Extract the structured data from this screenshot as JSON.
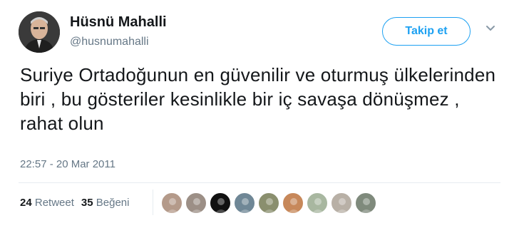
{
  "author": {
    "name": "Hüsnü Mahalli",
    "handle": "@husnumahalli"
  },
  "follow_button_label": "Takip et",
  "tweet": {
    "text": "Suriye Ortadoğunun en güvenilir ve oturmuş ülkelerinden biri , bu gösteriler kesinlikle bir iç savaşa dönüşmez , rahat olun",
    "timestamp": "22:57 - 20 Mar 2011"
  },
  "stats": {
    "retweets_count": "24",
    "retweets_label": "Retweet",
    "likes_count": "35",
    "likes_label": "Beğeni"
  },
  "likers": [
    {
      "icon": "liker-avatar",
      "color": "#b49a8a"
    },
    {
      "icon": "liker-avatar",
      "color": "#9c8f86"
    },
    {
      "icon": "liker-avatar",
      "color": "#111111"
    },
    {
      "icon": "liker-avatar",
      "color": "#6f8796"
    },
    {
      "icon": "liker-avatar",
      "color": "#8a8f6e"
    },
    {
      "icon": "liker-avatar",
      "color": "#c7885a"
    },
    {
      "icon": "liker-avatar",
      "color": "#a8b7a0"
    },
    {
      "icon": "liker-avatar",
      "color": "#b8b0a6"
    },
    {
      "icon": "liker-avatar",
      "color": "#7f8a7c"
    }
  ],
  "colors": {
    "link_blue": "#1da1f2",
    "secondary_text": "#657786",
    "primary_text": "#14171a"
  }
}
